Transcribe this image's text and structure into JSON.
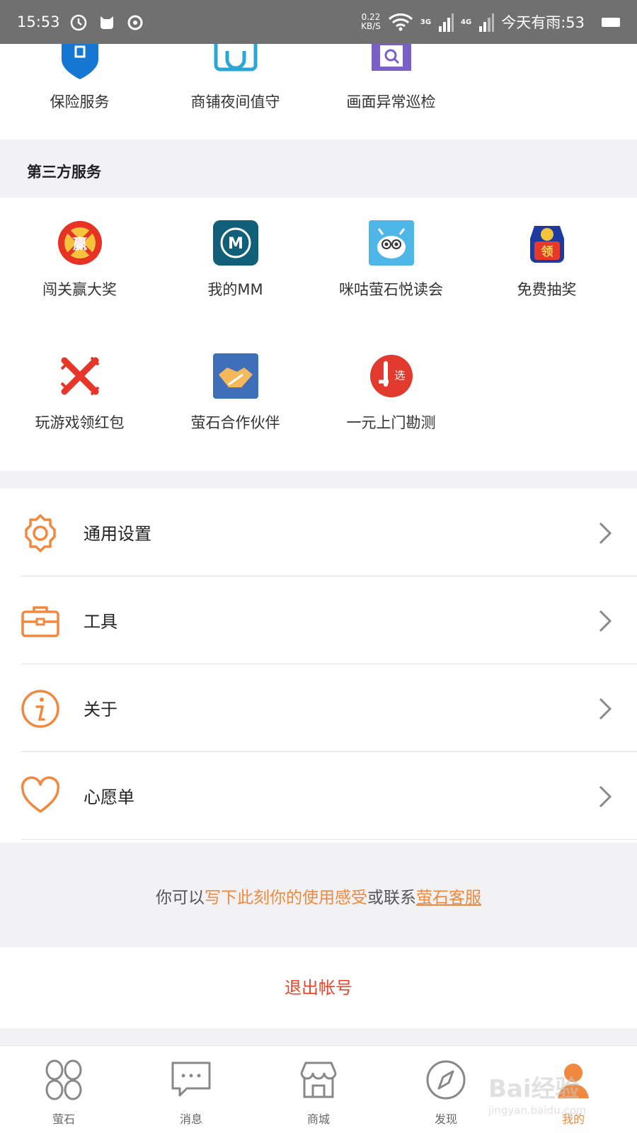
{
  "status_bar": {
    "time": "15:53",
    "speed_value": "0.22",
    "speed_unit": "KB/S",
    "net_3g": "3G",
    "net_4g": "4G",
    "weather": "今天有雨:53"
  },
  "top_services": [
    {
      "label": "保险服务",
      "icon": "insurance-shield-icon"
    },
    {
      "label": "商铺夜间值守",
      "icon": "shop-guard-icon"
    },
    {
      "label": "画面异常巡检",
      "icon": "video-inspection-icon"
    }
  ],
  "third_party": {
    "title": "第三方服务",
    "items": [
      {
        "label": "闯关赢大奖",
        "icon": "prize-badge-icon"
      },
      {
        "label": "我的MM",
        "icon": "mm-app-icon",
        "glyph": "M"
      },
      {
        "label": "咪咕萤石悦读会",
        "icon": "reading-robot-icon"
      },
      {
        "label": "免费抽奖",
        "icon": "lucky-bag-icon",
        "glyph": "领"
      },
      {
        "label": "玩游戏领红包",
        "icon": "game-red-packet-icon"
      },
      {
        "label": "萤石合作伙伴",
        "icon": "handshake-icon"
      },
      {
        "label": "一元上门勘测",
        "icon": "survey-select-icon",
        "glyph": "选"
      }
    ]
  },
  "menu": [
    {
      "label": "通用设置",
      "icon": "gear-icon"
    },
    {
      "label": "工具",
      "icon": "toolbox-icon"
    },
    {
      "label": "关于",
      "icon": "info-icon"
    },
    {
      "label": "心愿单",
      "icon": "heart-icon"
    }
  ],
  "feedback": {
    "prefix": "你可以",
    "link1": "写下此刻你的使用感受",
    "middle": "或联系",
    "link2": "萤石客服"
  },
  "logout": "退出帐号",
  "tabs": [
    {
      "label": "萤石",
      "icon": "ezviz-home-icon"
    },
    {
      "label": "消息",
      "icon": "message-icon"
    },
    {
      "label": "商城",
      "icon": "store-icon"
    },
    {
      "label": "发现",
      "icon": "compass-icon"
    },
    {
      "label": "我的",
      "icon": "profile-icon"
    }
  ],
  "watermark": {
    "brand": "Bai经验",
    "url": "jingyan.baidu.com"
  },
  "colors": {
    "accent": "#f0883e",
    "logout": "#e8452c",
    "statusbar": "#707070"
  }
}
